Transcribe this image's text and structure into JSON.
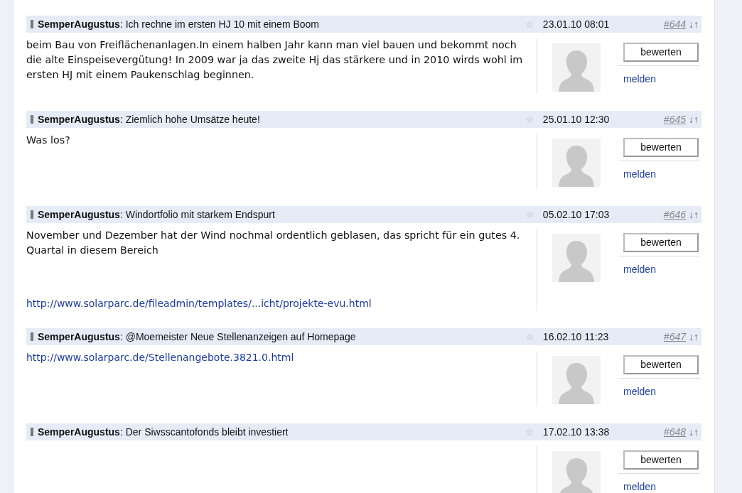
{
  "posts": [
    {
      "author": "SemperAugustus",
      "title": ": Ich rechne im ersten HJ 10 mit einem Boom",
      "date": "23.01.10 08:01",
      "number": "#644",
      "arrows": "↓↑",
      "body": [
        {
          "kind": "text",
          "text": "beim Bau von Freiflächenanlagen.In einem halben Jahr kann man viel bauen und bekommt noch die alte Einspeisevergütung! In 2009 war ja das zweite Hj das stärkere und in 2010 wirds wohl im ersten HJ mit einem Paukenschlag beginnen."
        }
      ],
      "rate_button": "bewerten",
      "report_link": "melden"
    },
    {
      "author": "SemperAugustus",
      "title": ": Ziemlich hohe Umsätze heute!",
      "date": "25.01.10 12:30",
      "number": "#645",
      "arrows": "↓↑",
      "body": [
        {
          "kind": "text",
          "text": "Was los?"
        }
      ],
      "rate_button": "bewerten",
      "report_link": "melden"
    },
    {
      "author": "SemperAugustus",
      "title": ": Windortfolio mit starkem Endspurt",
      "date": "05.02.10 17:03",
      "number": "#646",
      "arrows": "↓↑",
      "body": [
        {
          "kind": "text",
          "text": "November und Dezember hat der Wind nochmal ordentlich geblasen, das spricht für ein gutes 4. Quartal in diesem Bereich"
        },
        {
          "kind": "link",
          "text": "http://www.solarparc.de/fileadmin/templates/...icht/projekte-evu.html"
        }
      ],
      "rate_button": "bewerten",
      "report_link": "melden"
    },
    {
      "author": "SemperAugustus",
      "title": ": @Moemeister Neue Stellenanzeigen auf Homepage",
      "date": "16.02.10 11:23",
      "number": "#647",
      "arrows": "↓↑",
      "body": [
        {
          "kind": "link",
          "text": "http://www.solarparc.de/Stellenangebote.3821.0.html"
        }
      ],
      "rate_button": "bewerten",
      "report_link": "melden"
    },
    {
      "author": "SemperAugustus",
      "title": ": Der Siwsscantofonds bleibt investiert",
      "date": "17.02.10 13:38",
      "number": "#648",
      "arrows": "↓↑",
      "rate_button": "bewerten",
      "report_link": "melden"
    }
  ]
}
